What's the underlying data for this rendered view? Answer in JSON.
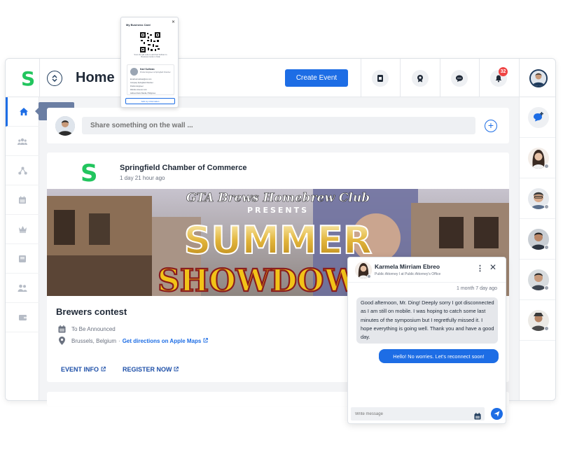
{
  "app": {
    "logo": "S",
    "page_title": "Home"
  },
  "header": {
    "create_event_label": "Create Event",
    "notification_count": "32",
    "icons": [
      "event-ticket-icon",
      "badge-icon",
      "chat-icon",
      "bell-icon"
    ]
  },
  "leftnav": {
    "tooltip": "Home",
    "items": [
      "home-icon",
      "groups-icon",
      "network-icon",
      "calendar-icon",
      "crown-icon",
      "inbox-icon",
      "people-icon",
      "wallet-icon"
    ]
  },
  "composer": {
    "placeholder": "Share something on the wall ..."
  },
  "post": {
    "logo": "S",
    "org_name": "Springfield Chamber of Commerce",
    "time_ago": "1 day 21 hour ago",
    "banner": {
      "line1": "GTA Brews Homebrew Club",
      "line2": "PRESENTS",
      "line3": "SUMMER",
      "line4": "SHOWDOWN"
    },
    "title": "Brewers contest",
    "date_text": "To Be Announced",
    "location_text": "Brussels, Belgium",
    "location_sep": "·",
    "directions_link": "Get directions on Apple Maps",
    "event_info_label": "EVENT INFO",
    "register_label": "REGISTER NOW"
  },
  "business_card": {
    "title": "My Business Card",
    "caption": "Scan the QR code to add Karl Sullivan to Business Cards in SGE",
    "name": "Karl Sullivan",
    "role": "Product Engineer at Springfield Chamber",
    "lines": [
      "Email   karl.sullivan@scc.com",
      "Company   Springfield Chamber",
      "Position   Engineer",
      "Website   www.scc.com",
      "Address   Metro Manila, Philippines"
    ],
    "button": "Add my information"
  },
  "chat": {
    "name": "Karmela Mirriam Ebreo",
    "subtitle": "Public Attorney I at Public Attorney's Office",
    "timestamp": "1 month 7 day ago",
    "incoming": "Good afternoon, Mr. Ding! Deeply sorry I got disconnected as I am still on mobile. I was hoping to catch some last minutes of the symposium but I regretfully missed it. I hope everything is going well. Thank you and have a good day.",
    "outgoing": "Hello! No worries. Let's reconnect soon!",
    "input_placeholder": "Write message"
  },
  "colors": {
    "accent": "#1d6de5",
    "brand_green": "#22c55e",
    "badge_red": "#ef4444"
  }
}
